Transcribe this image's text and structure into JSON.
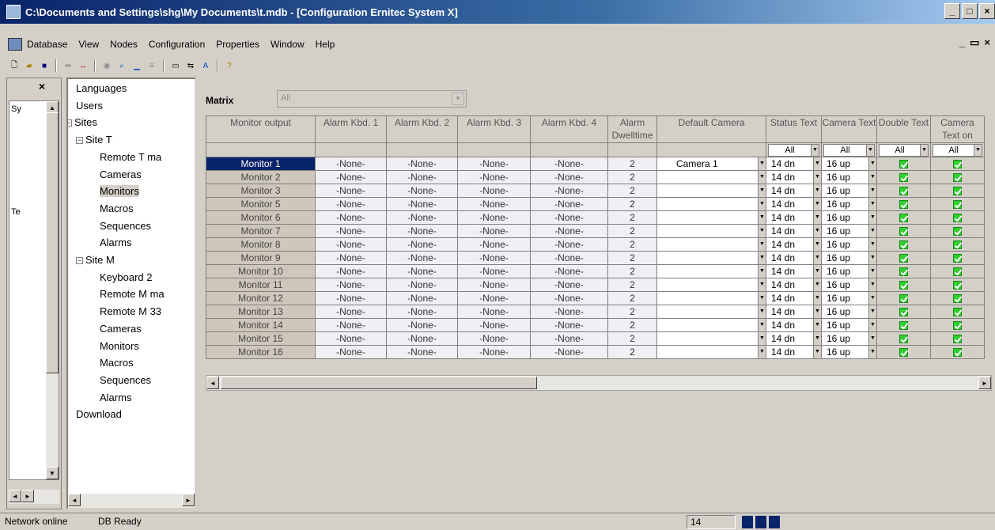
{
  "window": {
    "title": "C:\\Documents and Settings\\shg\\My Documents\\t.mdb - [Configuration Ernitec System X]",
    "buttons": [
      "_",
      "□",
      "×"
    ]
  },
  "menu": {
    "items": [
      "Database",
      "View",
      "Nodes",
      "Configuration",
      "Properties",
      "Window",
      "Help"
    ],
    "mdi_buttons": [
      "_",
      "▭",
      "×"
    ]
  },
  "toolbar": {
    "buttons": [
      "new-icon",
      "open-icon",
      "save-icon",
      "connect-icon",
      "disconnect-icon",
      "view-icon",
      "find-icon",
      "underline-icon",
      "align-icon",
      "window-icon",
      "arrows-icon",
      "font-icon",
      "help-icon"
    ]
  },
  "left_panel": {
    "close_label": "×",
    "nodes": [
      "Sy",
      "Te"
    ]
  },
  "tree": {
    "nodes": [
      {
        "label": "Languages",
        "level": 0
      },
      {
        "label": "Users",
        "level": 0
      },
      {
        "label": "Sites",
        "level": 0,
        "expander": "−"
      },
      {
        "label": "Site T",
        "level": 1,
        "expander": "−"
      },
      {
        "label": "Remote T ma",
        "level": 2
      },
      {
        "label": "Cameras",
        "level": 2
      },
      {
        "label": "Monitors",
        "level": 2
      },
      {
        "label": "Macros",
        "level": 2
      },
      {
        "label": "Sequences",
        "level": 2
      },
      {
        "label": "Alarms",
        "level": 2
      },
      {
        "label": "Site M",
        "level": 1,
        "expander": "−"
      },
      {
        "label": "Keyboard 2",
        "level": 2
      },
      {
        "label": "Remote M ma",
        "level": 2
      },
      {
        "label": "Remote M 33",
        "level": 2
      },
      {
        "label": "Cameras",
        "level": 2
      },
      {
        "label": "Monitors",
        "level": 2
      },
      {
        "label": "Macros",
        "level": 2
      },
      {
        "label": "Sequences",
        "level": 2
      },
      {
        "label": "Alarms",
        "level": 2
      },
      {
        "label": "Download",
        "level": 0
      }
    ],
    "selected": "Monitors"
  },
  "matrix": {
    "label": "Matrix",
    "value": "All"
  },
  "grid": {
    "columns": [
      {
        "key": "monitor",
        "label": "Monitor output"
      },
      {
        "key": "kbd1",
        "label": "Alarm Kbd. 1"
      },
      {
        "key": "kbd2",
        "label": "Alarm Kbd. 2"
      },
      {
        "key": "kbd3",
        "label": "Alarm Kbd. 3"
      },
      {
        "key": "kbd4",
        "label": "Alarm Kbd. 4"
      },
      {
        "key": "dwell",
        "label": "Alarm Dwelltime"
      },
      {
        "key": "camera",
        "label": "Default Camera"
      },
      {
        "key": "status",
        "label": "Status Text"
      },
      {
        "key": "camtext",
        "label": "Camera Text"
      },
      {
        "key": "double",
        "label": "Double Text"
      },
      {
        "key": "camtexton",
        "label": "Camera Text on"
      }
    ],
    "filters": {
      "status": "All",
      "camtext": "All",
      "double": "All",
      "camtexton": "All"
    },
    "rows": [
      {
        "monitor": "Monitor  1",
        "kbd1": "-None-",
        "kbd2": "-None-",
        "kbd3": "-None-",
        "kbd4": "-None-",
        "dwell": "2",
        "camera": "Camera    1",
        "status": "14 dn",
        "camtext": "16 up",
        "double": true,
        "camtexton": true
      },
      {
        "monitor": "Monitor  2",
        "kbd1": "-None-",
        "kbd2": "-None-",
        "kbd3": "-None-",
        "kbd4": "-None-",
        "dwell": "2",
        "camera": "",
        "status": "14 dn",
        "camtext": "16 up",
        "double": true,
        "camtexton": true
      },
      {
        "monitor": "Monitor  3",
        "kbd1": "-None-",
        "kbd2": "-None-",
        "kbd3": "-None-",
        "kbd4": "-None-",
        "dwell": "2",
        "camera": "",
        "status": "14 dn",
        "camtext": "16 up",
        "double": true,
        "camtexton": true
      },
      {
        "monitor": "Monitor  5",
        "kbd1": "-None-",
        "kbd2": "-None-",
        "kbd3": "-None-",
        "kbd4": "-None-",
        "dwell": "2",
        "camera": "",
        "status": "14 dn",
        "camtext": "16 up",
        "double": true,
        "camtexton": true
      },
      {
        "monitor": "Monitor  6",
        "kbd1": "-None-",
        "kbd2": "-None-",
        "kbd3": "-None-",
        "kbd4": "-None-",
        "dwell": "2",
        "camera": "",
        "status": "14 dn",
        "camtext": "16 up",
        "double": true,
        "camtexton": true
      },
      {
        "monitor": "Monitor  7",
        "kbd1": "-None-",
        "kbd2": "-None-",
        "kbd3": "-None-",
        "kbd4": "-None-",
        "dwell": "2",
        "camera": "",
        "status": "14 dn",
        "camtext": "16 up",
        "double": true,
        "camtexton": true
      },
      {
        "monitor": "Monitor  8",
        "kbd1": "-None-",
        "kbd2": "-None-",
        "kbd3": "-None-",
        "kbd4": "-None-",
        "dwell": "2",
        "camera": "",
        "status": "14 dn",
        "camtext": "16 up",
        "double": true,
        "camtexton": true
      },
      {
        "monitor": "Monitor  9",
        "kbd1": "-None-",
        "kbd2": "-None-",
        "kbd3": "-None-",
        "kbd4": "-None-",
        "dwell": "2",
        "camera": "",
        "status": "14 dn",
        "camtext": "16 up",
        "double": true,
        "camtexton": true
      },
      {
        "monitor": "Monitor 10",
        "kbd1": "-None-",
        "kbd2": "-None-",
        "kbd3": "-None-",
        "kbd4": "-None-",
        "dwell": "2",
        "camera": "",
        "status": "14 dn",
        "camtext": "16 up",
        "double": true,
        "camtexton": true
      },
      {
        "monitor": "Monitor 11",
        "kbd1": "-None-",
        "kbd2": "-None-",
        "kbd3": "-None-",
        "kbd4": "-None-",
        "dwell": "2",
        "camera": "",
        "status": "14 dn",
        "camtext": "16 up",
        "double": true,
        "camtexton": true
      },
      {
        "monitor": "Monitor 12",
        "kbd1": "-None-",
        "kbd2": "-None-",
        "kbd3": "-None-",
        "kbd4": "-None-",
        "dwell": "2",
        "camera": "",
        "status": "14 dn",
        "camtext": "16 up",
        "double": true,
        "camtexton": true
      },
      {
        "monitor": "Monitor 13",
        "kbd1": "-None-",
        "kbd2": "-None-",
        "kbd3": "-None-",
        "kbd4": "-None-",
        "dwell": "2",
        "camera": "",
        "status": "14 dn",
        "camtext": "16 up",
        "double": true,
        "camtexton": true
      },
      {
        "monitor": "Monitor 14",
        "kbd1": "-None-",
        "kbd2": "-None-",
        "kbd3": "-None-",
        "kbd4": "-None-",
        "dwell": "2",
        "camera": "",
        "status": "14 dn",
        "camtext": "16 up",
        "double": true,
        "camtexton": true
      },
      {
        "monitor": "Monitor 15",
        "kbd1": "-None-",
        "kbd2": "-None-",
        "kbd3": "-None-",
        "kbd4": "-None-",
        "dwell": "2",
        "camera": "",
        "status": "14 dn",
        "camtext": "16 up",
        "double": true,
        "camtexton": true
      },
      {
        "monitor": "Monitor 16",
        "kbd1": "-None-",
        "kbd2": "-None-",
        "kbd3": "-None-",
        "kbd4": "-None-",
        "dwell": "2",
        "camera": "",
        "status": "14 dn",
        "camtext": "16 up",
        "double": true,
        "camtexton": true
      }
    ],
    "selected_row": 0
  },
  "statusbar": {
    "network": "Network online",
    "db": "DB Ready",
    "count": "14"
  },
  "colors": {
    "selection": "#0a246a",
    "title_gradient_start": "#0a246a",
    "checkbox": "#2fcf2f"
  }
}
